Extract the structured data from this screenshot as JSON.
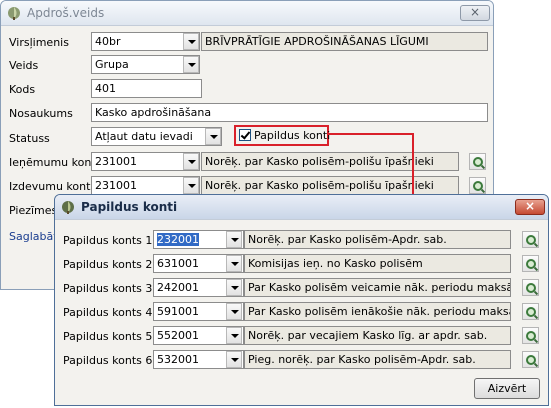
{
  "main_window": {
    "title": "Apdroš.veids",
    "close_symbol": "×",
    "fields": {
      "virsl": {
        "label": "Virsļimenis",
        "value": "40br",
        "description": "BRĪVPRĀTĪGIE APDROŠINĀŠANAS LĪGUMI"
      },
      "veids": {
        "label": "Veids",
        "value": "Grupa"
      },
      "kods": {
        "label": "Kods",
        "value": "401"
      },
      "nosaukums": {
        "label": "Nosaukums",
        "value": "Kasko apdrošināšana"
      },
      "statuss": {
        "label": "Statuss",
        "value": "Atļaut datu ievadi"
      },
      "papildus_checkbox": {
        "label": "Papildus konti",
        "checked": true
      },
      "ienemumu": {
        "label": "Ieņēmumu konts",
        "value": "231001",
        "description": "Norēķ. par Kasko polisēm-polišu īpašnieki"
      },
      "izdevumu": {
        "label": "Izdevumu konts",
        "value": "231001",
        "description": "Norēķ. par Kasko polisēm-polišu īpašnieki"
      },
      "piezimes": {
        "label": "Piezīmes"
      },
      "saglabats": {
        "label": "Saglabāts"
      }
    }
  },
  "dialog": {
    "title": "Papildus konti",
    "close_symbol": "×",
    "rows": [
      {
        "label": "Papildus konts 1",
        "value": "232001",
        "description": "Norēķ. par Kasko polisēm-Apdr. sab."
      },
      {
        "label": "Papildus konts 2",
        "value": "631001",
        "description": "Komisijas ieņ. no Kasko polisēm"
      },
      {
        "label": "Papildus konts 3",
        "value": "242001",
        "description": "Par Kasko polisēm veicamie nāk. periodu maksājumi"
      },
      {
        "label": "Papildus konts 4",
        "value": "591001",
        "description": "Par Kasko polisēm ienākošie nāk. periodu maksājumi"
      },
      {
        "label": "Papildus konts 5",
        "value": "552001",
        "description": "Norēķ. par vecajiem Kasko līg. ar apdr. sab."
      },
      {
        "label": "Papildus konts 6",
        "value": "532001",
        "description": "Pieg. norēķ. par Kasko polisēm-Apdr. sab."
      }
    ],
    "close_button": "Aizvērt"
  },
  "colors": {
    "highlight": "#d9202a",
    "selection": "#316ac5"
  }
}
